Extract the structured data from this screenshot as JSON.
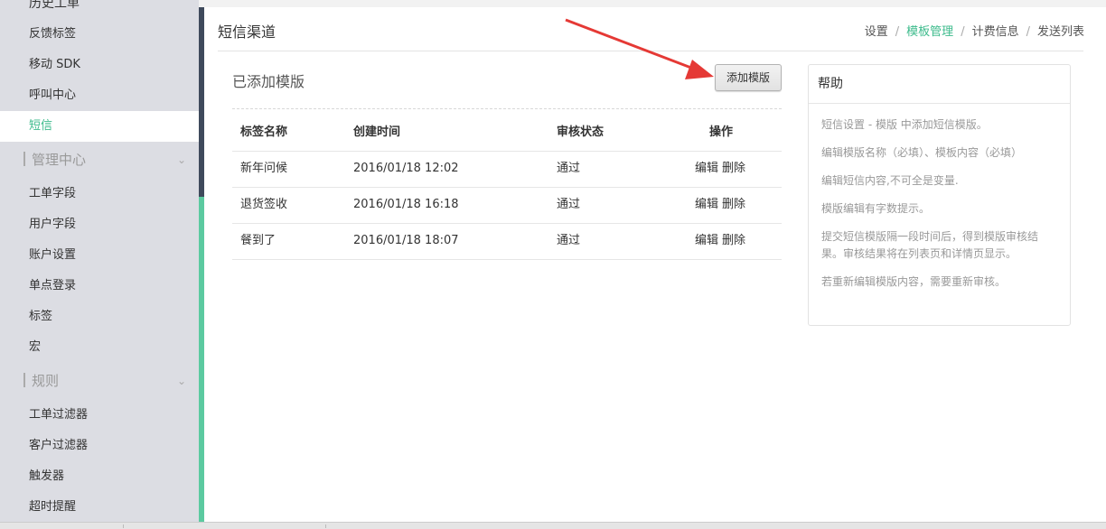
{
  "sidebar": {
    "cut_item": "历史工单",
    "items_top": [
      {
        "label": "反馈标签"
      },
      {
        "label": "移动 SDK"
      },
      {
        "label": "呼叫中心"
      },
      {
        "label": "短信"
      }
    ],
    "group_manage": "管理中心",
    "items_manage": [
      {
        "label": "工单字段"
      },
      {
        "label": "用户字段"
      },
      {
        "label": "账户设置"
      },
      {
        "label": "单点登录"
      },
      {
        "label": "标签"
      },
      {
        "label": "宏"
      }
    ],
    "group_rules": "规则",
    "items_rules": [
      {
        "label": "工单过滤器"
      },
      {
        "label": "客户过滤器"
      },
      {
        "label": "触发器"
      },
      {
        "label": "超时提醒"
      }
    ]
  },
  "header": {
    "title": "短信渠道",
    "breadcrumb": [
      "设置",
      "模板管理",
      "计费信息",
      "发送列表"
    ],
    "breadcrumb_sep": "/"
  },
  "main": {
    "section_title": "已添加模版",
    "add_button": "添加模版",
    "table": {
      "headers": [
        "标签名称",
        "创建时间",
        "审核状态",
        "操作"
      ],
      "rows": [
        {
          "name": "新年问候",
          "time": "2016/01/18 12:02",
          "status": "通过",
          "edit": "编辑",
          "delete": "删除"
        },
        {
          "name": "退货签收",
          "time": "2016/01/18 16:18",
          "status": "通过",
          "edit": "编辑",
          "delete": "删除"
        },
        {
          "name": "餐到了",
          "time": "2016/01/18 18:07",
          "status": "通过",
          "edit": "编辑",
          "delete": "删除"
        }
      ]
    }
  },
  "help": {
    "title": "帮助",
    "lines": [
      "短信设置 - 模版 中添加短信模版。",
      "编辑模版名称（必填）、模板内容（必填）",
      "编辑短信内容,不可全是变量.",
      "模版编辑有字数提示。",
      "提交短信模版隔一段时间后，得到模版审核结果。审核结果将在列表页和详情页显示。",
      "若重新编辑模版内容，需要重新审核。"
    ]
  },
  "colors": {
    "accent": "#3dbb8c",
    "sidebar_bg": "#dcdde3",
    "sidebar_dark_bar": "#3f4a5c",
    "sidebar_green_bar": "#5ccaa0",
    "arrow": "#e53935"
  },
  "icons": {
    "group_chevron": "chevron-down-icon",
    "annotation": "red-arrow-annotation"
  }
}
